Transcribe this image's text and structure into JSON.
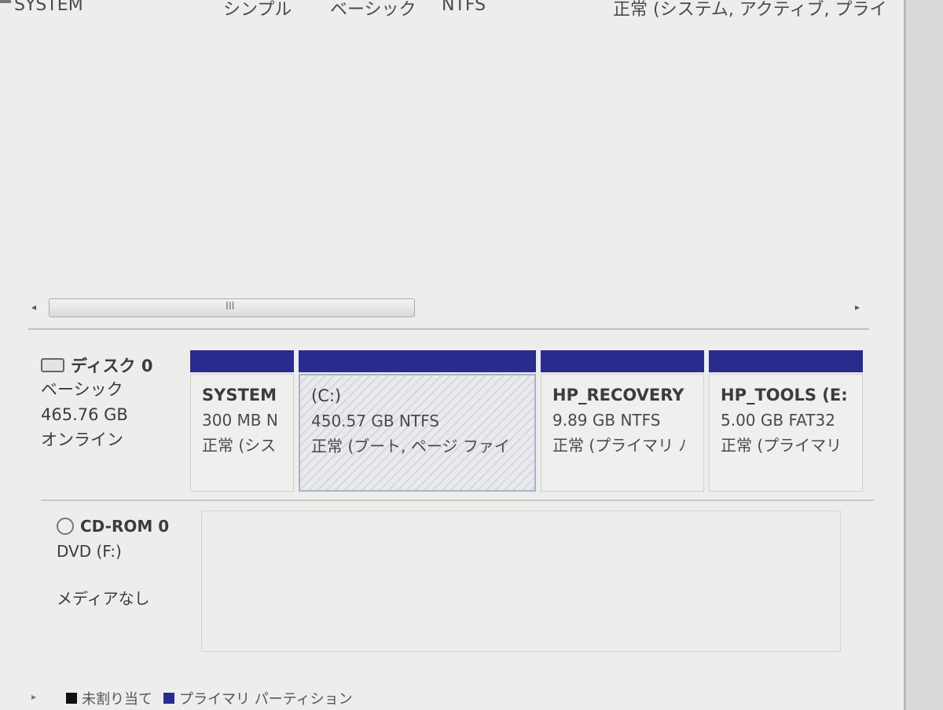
{
  "volume_row": {
    "name": "SYSTEM",
    "layout": "シンプル",
    "type": "ベーシック",
    "filesystem": "NTFS",
    "status": "正常 (システム, アクティブ, プライ"
  },
  "scrollbar": {
    "left_arrow": "◂",
    "right_arrow": "▸",
    "grip": "III"
  },
  "disk0": {
    "title": "ディスク 0",
    "type": "ベーシック",
    "size": "465.76 GB",
    "state": "オンライン",
    "partitions": [
      {
        "name": "SYSTEM",
        "size": "300 MB N",
        "status": "正常 (シス"
      },
      {
        "name": "(C:)",
        "size": "450.57 GB NTFS",
        "status": "正常 (ブート, ページ ファイ"
      },
      {
        "name": "HP_RECOVERY",
        "size": "9.89 GB NTFS",
        "status": "正常 (プライマリ ﾉ"
      },
      {
        "name": "HP_TOOLS  (E:",
        "size": "5.00 GB FAT32",
        "status": "正常 (プライマリ"
      }
    ]
  },
  "cdrom0": {
    "title": "CD-ROM 0",
    "drive": "DVD (F:)",
    "media": "メディアなし"
  },
  "legend": {
    "unallocated": "未割り当て",
    "primary": "プライマリ パーティション",
    "unallocated_color": "#111111",
    "primary_color": "#2a2b8e"
  }
}
